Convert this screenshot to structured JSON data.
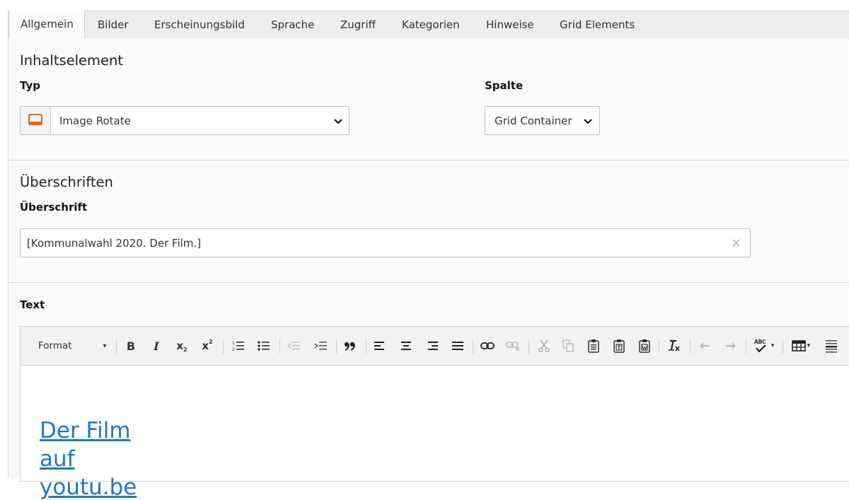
{
  "tabs": [
    {
      "label": "Allgemein",
      "active": true
    },
    {
      "label": "Bilder"
    },
    {
      "label": "Erscheinungsbild"
    },
    {
      "label": "Sprache"
    },
    {
      "label": "Zugriff"
    },
    {
      "label": "Kategorien"
    },
    {
      "label": "Hinweise"
    },
    {
      "label": "Grid Elements"
    }
  ],
  "content_element": {
    "title": "Inhaltselement",
    "type_label": "Typ",
    "type_value": "Image Rotate",
    "type_icon": "image-rotate-icon",
    "column_label": "Spalte",
    "column_value": "Grid Container"
  },
  "headers": {
    "title": "Überschriften",
    "header_label": "Überschrift",
    "header_value": "[Kommunalwahl 2020. Der Film.]",
    "clear_symbol": "×"
  },
  "text_field": {
    "label": "Text",
    "toolbar": {
      "format_label": "Format",
      "bold": "B",
      "italic": "I",
      "subscript": "x",
      "subscript_mark": "2",
      "superscript": "x",
      "superscript_mark": "2",
      "spellcheck_label": "ABC"
    },
    "content_lines": [
      "Der Film",
      "auf",
      "youtu.be"
    ]
  },
  "colors": {
    "accent": "#1a7bbf",
    "type_icon": "#e8601c"
  }
}
